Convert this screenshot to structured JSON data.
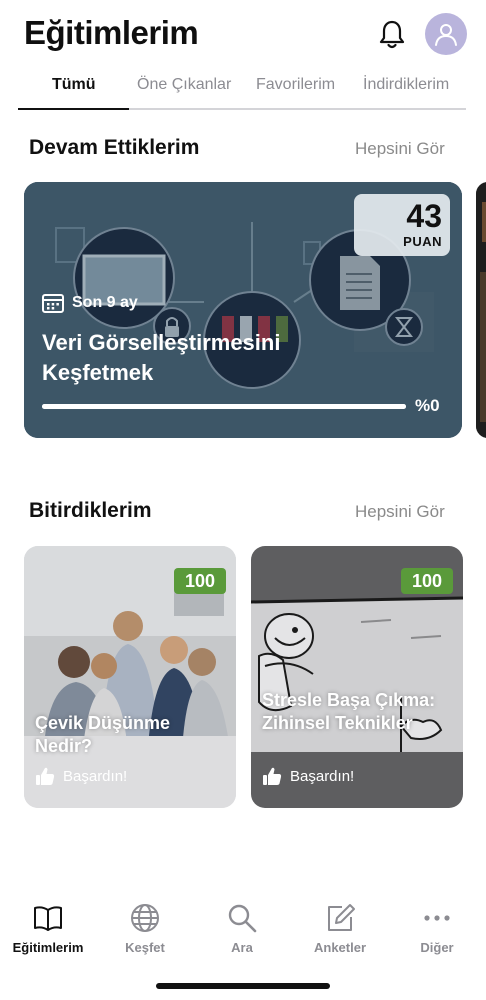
{
  "header": {
    "title": "Eğitimlerim",
    "bell_icon": "bell-icon",
    "avatar_icon": "user-icon"
  },
  "tabs": [
    {
      "label": "Tümü",
      "active": true
    },
    {
      "label": "Öne Çıkanlar",
      "active": false
    },
    {
      "label": "Favorilerim",
      "active": false
    },
    {
      "label": "İndirdiklerim",
      "active": false
    }
  ],
  "continuing": {
    "title": "Devam Ettiklerim",
    "see_all": "Hepsini Gör",
    "card": {
      "points_value": "43",
      "points_label": "PUAN",
      "date_icon": "calendar-icon",
      "date_text": "Son 9 ay",
      "title": "Veri Görselleştirmesini Keşfetmek",
      "progress_text": "%0",
      "progress_percent": 0
    }
  },
  "completed": {
    "title": "Bitirdiklerim",
    "see_all": "Hepsini Gör",
    "cards": [
      {
        "score": "100",
        "title": "Çevik Düşünme Nedir?",
        "status": "Başardın!",
        "status_icon": "thumbs-up-icon"
      },
      {
        "score": "100",
        "title": "Stresle Başa Çıkma: Zihinsel Teknikler",
        "status": "Başardın!",
        "status_icon": "thumbs-up-icon"
      }
    ]
  },
  "bottom_nav": [
    {
      "label": "Eğitimlerim",
      "icon": "book-icon",
      "active": true
    },
    {
      "label": "Keşfet",
      "icon": "globe-icon",
      "active": false
    },
    {
      "label": "Ara",
      "icon": "search-icon",
      "active": false
    },
    {
      "label": "Anketler",
      "icon": "edit-icon",
      "active": false
    },
    {
      "label": "Diğer",
      "icon": "more-icon",
      "active": false
    }
  ],
  "colors": {
    "accent": "#111111",
    "score_badge": "#5a9a3a",
    "avatar": "#b9b4dc",
    "inactive": "#8c8c92"
  }
}
